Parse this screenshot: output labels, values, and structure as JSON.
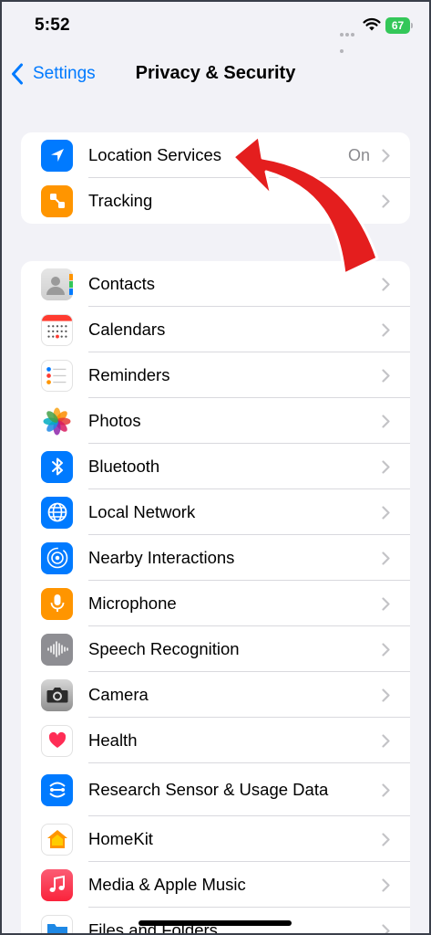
{
  "status": {
    "time": "5:52",
    "battery": "67"
  },
  "nav": {
    "back_label": "Settings",
    "title": "Privacy & Security"
  },
  "group1": [
    {
      "label": "Location Services",
      "value": "On",
      "icon": "location-arrow-icon",
      "color": "#007aff"
    },
    {
      "label": "Tracking",
      "icon": "tracking-icon",
      "color": "#ff9500"
    }
  ],
  "group2": [
    {
      "label": "Contacts",
      "icon": "contacts-icon"
    },
    {
      "label": "Calendars",
      "icon": "calendar-icon"
    },
    {
      "label": "Reminders",
      "icon": "reminders-icon"
    },
    {
      "label": "Photos",
      "icon": "photos-icon"
    },
    {
      "label": "Bluetooth",
      "icon": "bluetooth-icon",
      "color": "#007aff"
    },
    {
      "label": "Local Network",
      "icon": "globe-icon",
      "color": "#007aff"
    },
    {
      "label": "Nearby Interactions",
      "icon": "nearby-icon",
      "color": "#007aff"
    },
    {
      "label": "Microphone",
      "icon": "microphone-icon",
      "color": "#ff9500"
    },
    {
      "label": "Speech Recognition",
      "icon": "waveform-icon",
      "color": "#8e8e93"
    },
    {
      "label": "Camera",
      "icon": "camera-icon",
      "color": "#636366"
    },
    {
      "label": "Health",
      "icon": "heart-icon",
      "color": "#ff2d55"
    },
    {
      "label": "Research Sensor & Usage Data",
      "icon": "research-icon",
      "color": "#007aff"
    },
    {
      "label": "HomeKit",
      "icon": "home-icon",
      "color": "#ff9500"
    },
    {
      "label": "Media & Apple Music",
      "icon": "music-note-icon",
      "color": "#fc3c44"
    },
    {
      "label": "Files and Folders",
      "icon": "folder-icon",
      "color": "#1e88e5"
    }
  ]
}
